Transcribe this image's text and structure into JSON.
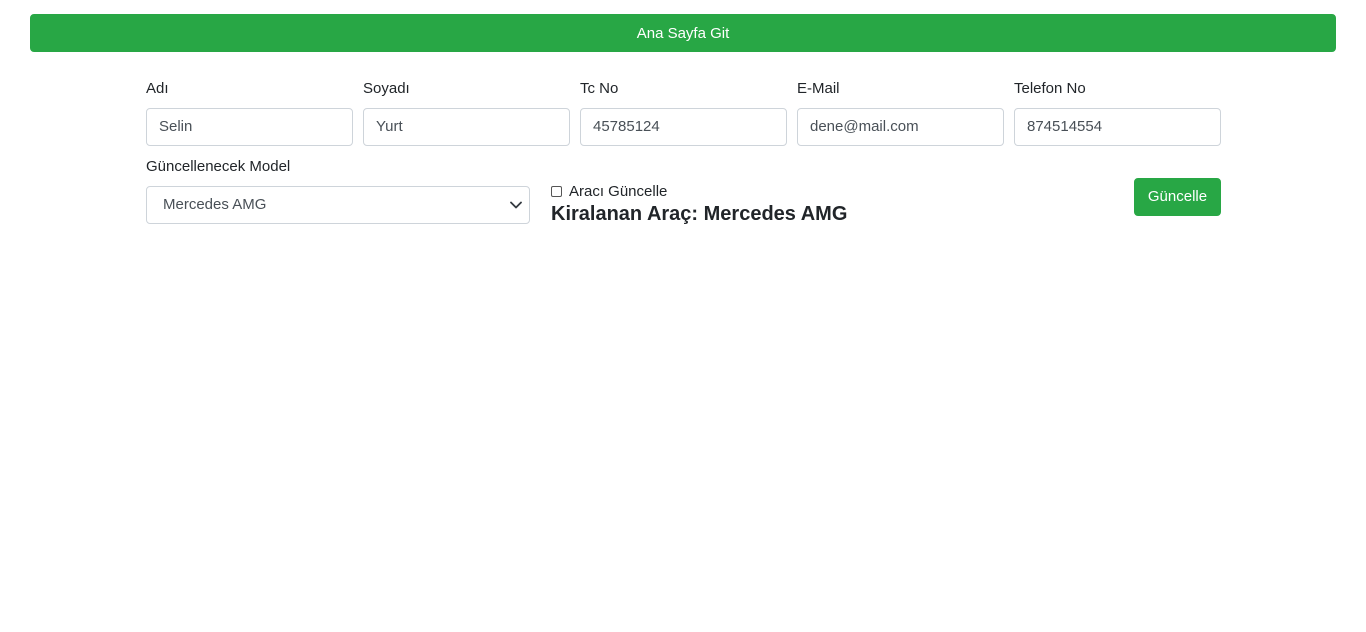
{
  "header": {
    "home_button": "Ana Sayfa Git"
  },
  "form": {
    "fields": [
      {
        "label": "Adı",
        "value": "Selin"
      },
      {
        "label": "Soyadı",
        "value": "Yurt"
      },
      {
        "label": "Tc No",
        "value": "45785124"
      },
      {
        "label": "E-Mail",
        "value": "dene@mail.com"
      },
      {
        "label": "Telefon No",
        "value": "874514554"
      }
    ],
    "model_label": "Güncellenecek Model",
    "model_selected": "Mercedes AMG",
    "checkbox_label": "Aracı Güncelle",
    "checkbox_checked": false,
    "rented_vehicle": "Kiralanan Araç: Mercedes AMG",
    "update_button": "Güncelle"
  },
  "colors": {
    "primary_green": "#28a745",
    "input_border": "#ced4da",
    "text": "#212529"
  }
}
